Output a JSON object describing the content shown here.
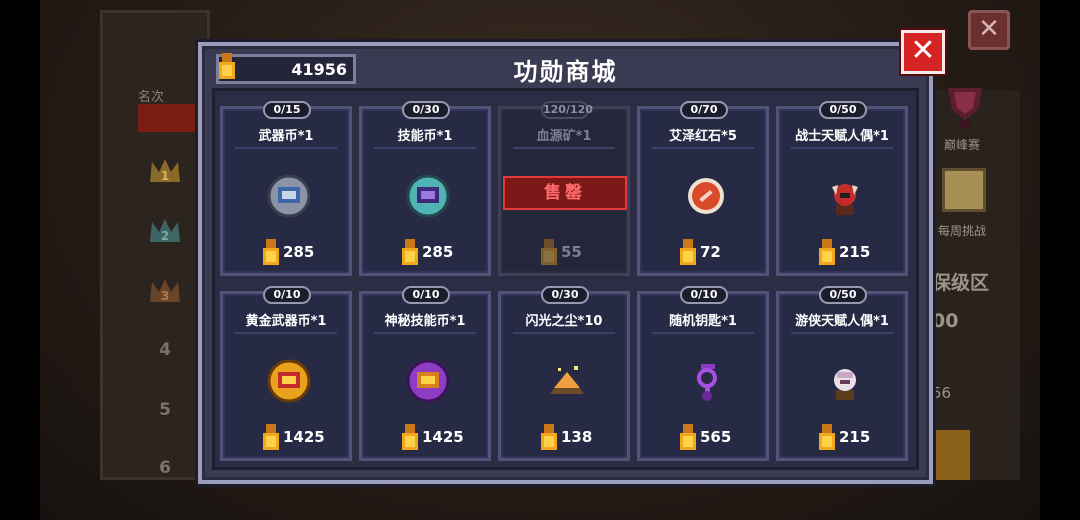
{
  "background": {
    "rank_header": "名次",
    "ranks": [
      "1",
      "2",
      "3",
      "4",
      "5",
      "6"
    ],
    "close_label": "✕",
    "peak_label": "巅峰赛",
    "weekly_label": "每周挑战",
    "protect_label": "保级区",
    "side_number_a": "00",
    "side_number_b": "56"
  },
  "shop": {
    "title": "功勋商城",
    "balance": "41956",
    "close_label": "✕",
    "sold_out_label": "售罄",
    "items": [
      {
        "name": "武器币*1",
        "stock": "0/15",
        "price": "285",
        "icon": "weapon-coin-icon",
        "sold_out": false
      },
      {
        "name": "技能币*1",
        "stock": "0/30",
        "price": "285",
        "icon": "skill-coin-icon",
        "sold_out": false
      },
      {
        "name": "血源矿*1",
        "stock": "120/120",
        "price": "55",
        "icon": "blood-ore-icon",
        "sold_out": true
      },
      {
        "name": "艾泽红石*5",
        "stock": "0/70",
        "price": "72",
        "icon": "red-stone-icon",
        "sold_out": false
      },
      {
        "name": "战士天赋人偶*1",
        "stock": "0/50",
        "price": "215",
        "icon": "warrior-doll-icon",
        "sold_out": false
      },
      {
        "name": "黄金武器币*1",
        "stock": "0/10",
        "price": "1425",
        "icon": "gold-weapon-coin-icon",
        "sold_out": false
      },
      {
        "name": "神秘技能币*1",
        "stock": "0/10",
        "price": "1425",
        "icon": "mystic-skill-coin-icon",
        "sold_out": false
      },
      {
        "name": "闪光之尘*10",
        "stock": "0/30",
        "price": "138",
        "icon": "flash-dust-icon",
        "sold_out": false
      },
      {
        "name": "随机钥匙*1",
        "stock": "0/10",
        "price": "565",
        "icon": "random-key-icon",
        "sold_out": false
      },
      {
        "name": "游侠天赋人偶*1",
        "stock": "0/50",
        "price": "215",
        "icon": "ranger-doll-icon",
        "sold_out": false
      }
    ]
  },
  "colors": {
    "medal_gold": "#f2a81d",
    "close_red": "#d42424",
    "soldout_red": "#7c1818"
  }
}
